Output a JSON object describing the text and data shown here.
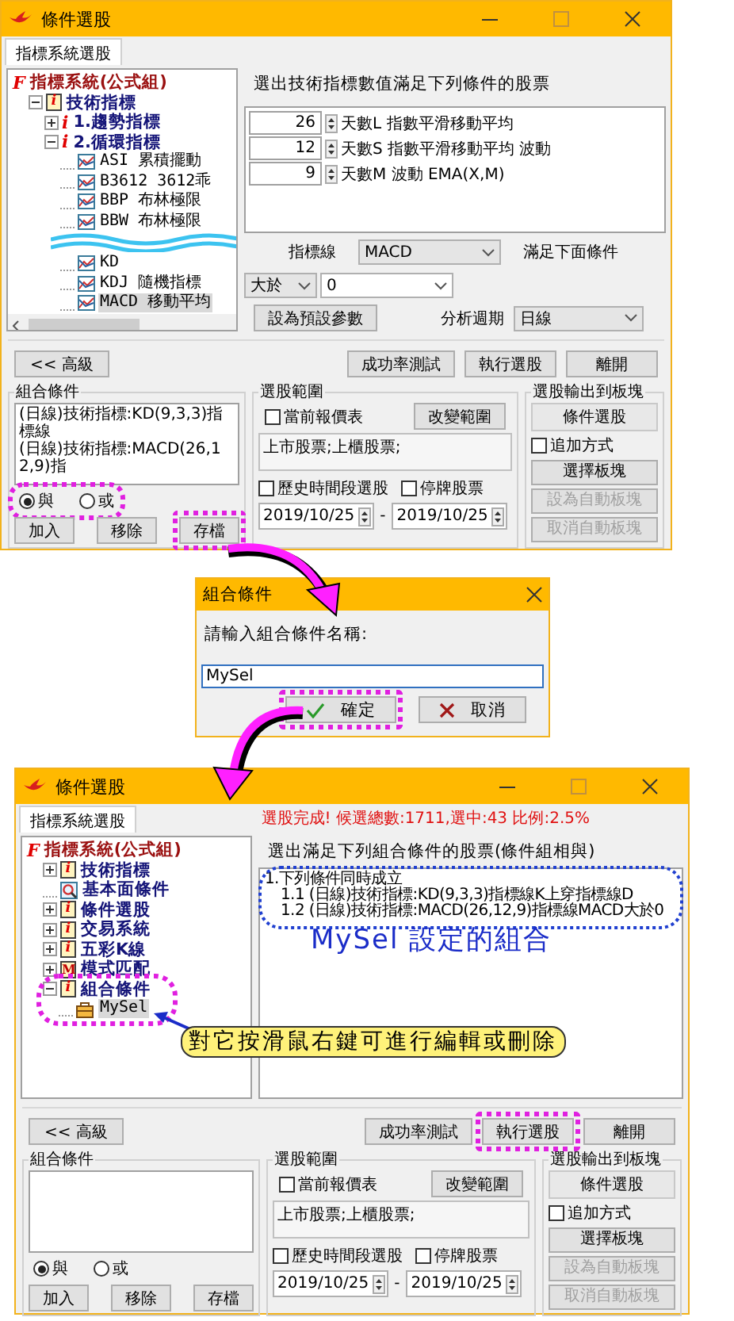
{
  "top_window": {
    "kind": "indicator",
    "title": "條件選股",
    "tab": {
      "label": "指標系統選股",
      "selected": true
    },
    "tree": [
      {
        "kind": "root",
        "label": "指標系統(公式組)",
        "glyph": "F",
        "selected": false,
        "children": [
          {
            "kind": "category",
            "label": "技術指標",
            "glyph": "i",
            "expanded": true,
            "selected": false,
            "children": [
              {
                "kind": "group",
                "label": "1.趨勢指標",
                "glyph": "i",
                "expanded": false,
                "selected": false
              },
              {
                "kind": "group",
                "label": "2.循環指標",
                "glyph": "i",
                "expanded": true,
                "selected": false,
                "children": [
                  {
                    "kind": "indicator",
                    "label": "ASI 累積擺動",
                    "selected": false
                  },
                  {
                    "kind": "indicator",
                    "label": "B3612 3612乖",
                    "selected": false
                  },
                  {
                    "kind": "indicator",
                    "label": "BBP 布林極限",
                    "selected": false
                  },
                  {
                    "kind": "indicator",
                    "label": "BBW 布林極限",
                    "selected": false
                  },
                  {
                    "kind": "elided"
                  },
                  {
                    "kind": "indicator",
                    "label": "KD",
                    "selected": false
                  },
                  {
                    "kind": "indicator",
                    "label": "KDJ 隨機指標",
                    "selected": false
                  },
                  {
                    "kind": "indicator",
                    "label": "MACD 移動平均",
                    "selected": true
                  }
                ]
              }
            ]
          }
        ]
      }
    ],
    "panel": {
      "heading": "選出技術指標數值滿足下列條件的股票",
      "params": [
        {
          "value": "26",
          "label": "天數L 指數平滑移動平均"
        },
        {
          "value": "12",
          "label": "天數S 指數平滑移動平均 波動"
        },
        {
          "value": "9",
          "label": "天數M 波動 EMA(X,M)"
        }
      ],
      "indicator": {
        "label": "指標線",
        "value": "MACD",
        "note": "滿足下面條件"
      },
      "comparator": {
        "operator": "大於",
        "value": "0"
      },
      "default_button": "設為預設參數",
      "period": {
        "label": "分析週期",
        "value": "日線"
      }
    },
    "advanced_button": "<< 高級",
    "actions": [
      {
        "label": "成功率測試",
        "highlighted": false
      },
      {
        "label": "執行選股",
        "highlighted": false
      },
      {
        "label": "離開",
        "highlighted": false
      }
    ],
    "combo": {
      "title": "組合條件",
      "lines": [
        "(日線)技術指標:KD(9,3,3)指標線",
        "(日線)技術指標:MACD(26,12,9)指"
      ],
      "logic": {
        "highlighted": true,
        "options": [
          {
            "label": "與",
            "selected": true
          },
          {
            "label": "或",
            "selected": false
          }
        ]
      },
      "buttons": [
        {
          "label": "加入",
          "highlighted": false
        },
        {
          "label": "移除",
          "highlighted": false
        },
        {
          "label": "存檔",
          "highlighted": true
        }
      ]
    },
    "scope": {
      "title": "選股範圍",
      "quote_table": {
        "label": "當前報價表",
        "checked": false
      },
      "change_button": "改變範圍",
      "markets": "上市股票;上櫃股票;",
      "history": {
        "label": "歷史時間段選股",
        "checked": false
      },
      "suspended": {
        "label": "停牌股票",
        "checked": false
      },
      "start_date": "2019/10/25",
      "separator": "-",
      "end_date": "2019/10/25"
    },
    "output": {
      "title": "選股輸出到板塊",
      "block_name": "條件選股",
      "append": {
        "label": "追加方式",
        "checked": false
      },
      "buttons": [
        {
          "label": "選擇板塊",
          "disabled": false
        },
        {
          "label": "設為自動板塊",
          "disabled": true
        },
        {
          "label": "取消自動板塊",
          "disabled": true
        }
      ]
    }
  },
  "dialog": {
    "title": "組合條件",
    "prompt": "請輸入組合條件名稱:",
    "value": "MySel",
    "buttons": [
      {
        "kind": "confirm",
        "label": "確定",
        "highlighted": true
      },
      {
        "kind": "cancel",
        "label": "取消",
        "highlighted": false
      }
    ]
  },
  "bottom_window": {
    "kind": "combination",
    "title": "條件選股",
    "tab": {
      "label": "指標系統選股",
      "selected": true
    },
    "status": "選股完成! 候選總數:1711,選中:43 比例:2.5%",
    "tree": [
      {
        "kind": "root",
        "label": "指標系統(公式組)",
        "glyph": "F",
        "selected": false,
        "children": [
          {
            "kind": "category",
            "label": "技術指標",
            "glyph": "i",
            "expanded": false,
            "selected": false,
            "highlighted": false
          },
          {
            "kind": "fundamental",
            "label": "基本面條件",
            "selected": false,
            "highlighted": false
          },
          {
            "kind": "category",
            "label": "條件選股",
            "glyph": "i",
            "expanded": false,
            "selected": false,
            "highlighted": false
          },
          {
            "kind": "category",
            "label": "交易系統",
            "glyph": "i",
            "expanded": false,
            "selected": false,
            "highlighted": false
          },
          {
            "kind": "category",
            "label": "五彩K線",
            "glyph": "i",
            "expanded": false,
            "selected": false,
            "highlighted": false
          },
          {
            "kind": "pattern",
            "label": "模式匹配",
            "glyph": "M",
            "expanded": false,
            "selected": false,
            "highlighted": false
          },
          {
            "kind": "category",
            "label": "組合條件",
            "glyph": "i",
            "expanded": true,
            "selected": false,
            "highlighted": true,
            "children": [
              {
                "kind": "saved",
                "label": "MySel",
                "selected": true
              }
            ]
          }
        ]
      }
    ],
    "panel": {
      "heading": "選出滿足下列組合條件的股票(條件組相與)",
      "highlighted": true,
      "results": [
        {
          "text": "1.下列條件同時成立",
          "children": [
            {
              "text": "1.1 (日線)技術指標:KD(9,3,3)指標線K上穿指標線D"
            },
            {
              "text": "1.2 (日線)技術指標:MACD(26,12,9)指標線MACD大於0"
            }
          ]
        }
      ]
    },
    "annotations": [
      {
        "kind": "label",
        "text": "MySel 設定的組合"
      },
      {
        "kind": "callout",
        "text": "對它按滑鼠右鍵可進行編輯或刪除"
      }
    ],
    "advanced_button": "<< 高級",
    "actions": [
      {
        "label": "成功率測試",
        "highlighted": false
      },
      {
        "label": "執行選股",
        "highlighted": true
      },
      {
        "label": "離開",
        "highlighted": false
      }
    ],
    "combo": {
      "title": "組合條件",
      "logic": {
        "highlighted": false,
        "options": [
          {
            "label": "與",
            "selected": true
          },
          {
            "label": "或",
            "selected": false
          }
        ]
      },
      "buttons": [
        {
          "label": "加入",
          "highlighted": false
        },
        {
          "label": "移除",
          "highlighted": false
        },
        {
          "label": "存檔",
          "highlighted": false
        }
      ]
    },
    "scope": {
      "title": "選股範圍",
      "quote_table": {
        "label": "當前報價表",
        "checked": false
      },
      "change_button": "改變範圍",
      "markets": "上市股票;上櫃股票;",
      "history": {
        "label": "歷史時間段選股",
        "checked": false
      },
      "suspended": {
        "label": "停牌股票",
        "checked": false
      },
      "start_date": "2019/10/25",
      "separator": "-",
      "end_date": "2019/10/25"
    },
    "output": {
      "title": "選股輸出到板塊",
      "block_name": "條件選股",
      "append": {
        "label": "追加方式",
        "checked": false
      },
      "buttons": [
        {
          "label": "選擇板塊",
          "disabled": false
        },
        {
          "label": "設為自動板塊",
          "disabled": true
        },
        {
          "label": "取消自動板塊",
          "disabled": true
        }
      ]
    }
  }
}
